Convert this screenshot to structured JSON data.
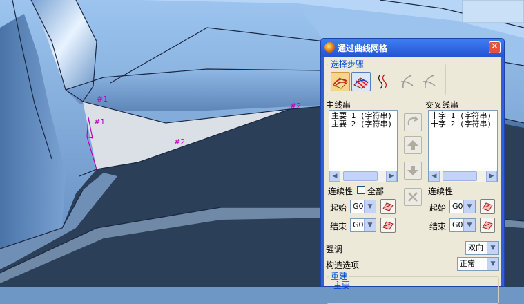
{
  "viewport": {
    "labels": [
      "#1",
      "#1",
      "#2",
      "#2"
    ]
  },
  "dialog": {
    "title": "通过曲线网格",
    "close_label": "✕",
    "steps": {
      "title": "选择步骤"
    },
    "primary": {
      "title": "主线串",
      "items": [
        "主要 1 (字符串)",
        "主要 2 (字符串)"
      ],
      "continuity_label": "连续性",
      "all_label": "全部",
      "all_checked": false,
      "start_label": "起始",
      "start_value": "G0",
      "end_label": "结束",
      "end_value": "G0"
    },
    "cross": {
      "title": "交叉线串",
      "items": [
        "十字 1 (字符串)",
        "十字 2 (字符串)"
      ],
      "continuity_label": "连续性",
      "start_label": "起始",
      "start_value": "G0",
      "end_label": "结束",
      "end_value": "G0"
    },
    "emphasis": {
      "label": "强调",
      "value": "双向"
    },
    "construction": {
      "label": "构造选项",
      "value": "正常"
    },
    "rebuild": {
      "title": "重建",
      "sub_label": "主要"
    }
  },
  "colors": {
    "title_bar": "#2f60d6",
    "panel": "#ece9d8",
    "group_title": "#0046d5",
    "annotation": "#c000c0",
    "surface": "#6f97c6"
  }
}
